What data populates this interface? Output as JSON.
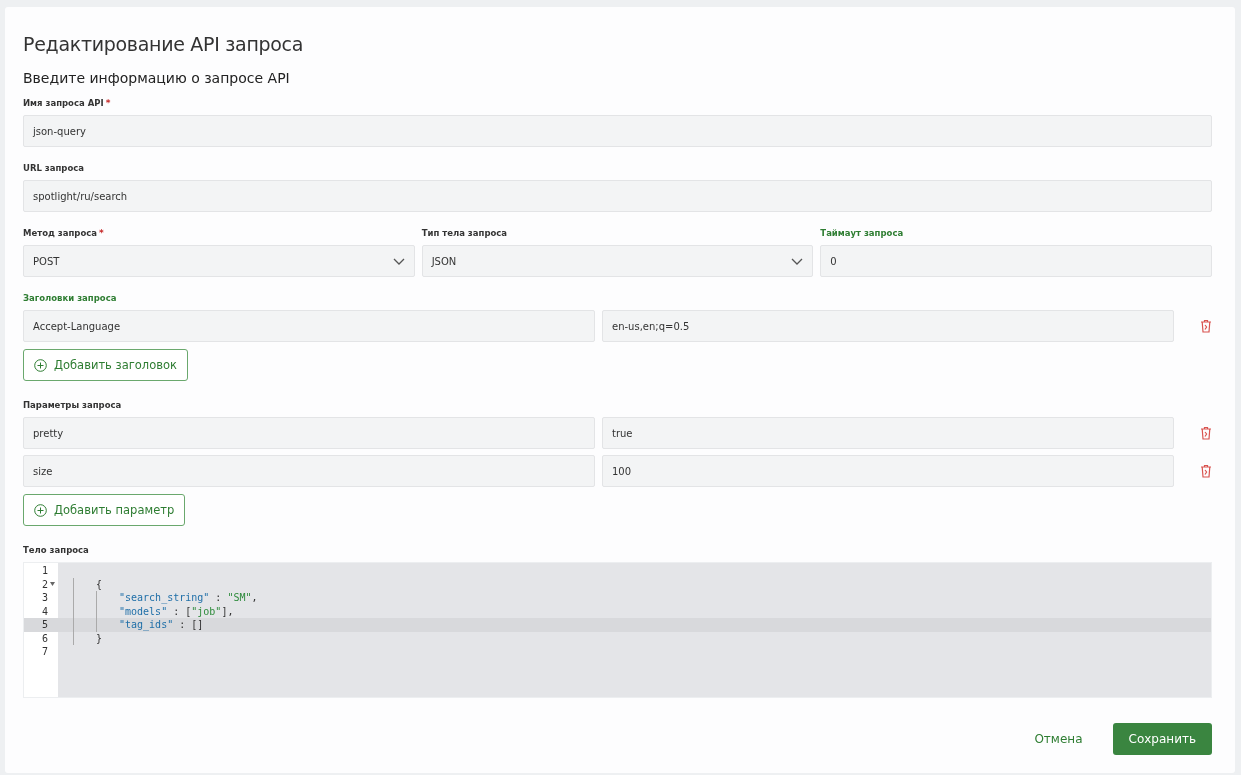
{
  "dialog": {
    "title": "Редактирование API запроса",
    "subtitle": "Введите информацию о запросе API"
  },
  "fields": [
    {
      "label": "Имя запроса API",
      "required_mark": "*",
      "highlighted": false,
      "kind": "text",
      "value": "json-query"
    },
    {
      "label": "URL запроса",
      "highlighted": false,
      "kind": "text",
      "value": "spotlight/ru/search"
    }
  ],
  "row_fields": [
    {
      "label": "Метод запроса",
      "required_mark": "*",
      "highlighted": false,
      "kind": "select",
      "value": "POST"
    },
    {
      "label": "Тип тела запроса",
      "highlighted": false,
      "kind": "select",
      "value": "JSON"
    },
    {
      "label": "Таймаут запроса",
      "highlighted": true,
      "kind": "text",
      "value": "0"
    }
  ],
  "groups": [
    {
      "label": "Заголовки запроса",
      "highlighted": true,
      "rows": [
        {
          "key": "Accept-Language",
          "value": "en-us,en;q=0.5"
        }
      ],
      "add_button": "Добавить заголовок"
    },
    {
      "label": "Параметры запроса",
      "highlighted": false,
      "rows": [
        {
          "key": "pretty",
          "value": "true"
        },
        {
          "key": "size",
          "value": "100"
        }
      ],
      "add_button": "Добавить параметр"
    }
  ],
  "body": {
    "label": "Тело запроса",
    "lines": [
      {
        "number": "1",
        "foldable": false,
        "active": false
      },
      {
        "number": "2",
        "foldable": true,
        "active": false,
        "tokens": [
          {
            "kind": "punct",
            "text": "    {"
          }
        ]
      },
      {
        "number": "3",
        "foldable": false,
        "active": false,
        "tokens": [
          {
            "kind": "key",
            "text": "        \"search_string\""
          },
          {
            "kind": "punct",
            "text": " : "
          },
          {
            "kind": "string",
            "text": "\"SM\""
          },
          {
            "kind": "punct",
            "text": ","
          }
        ]
      },
      {
        "number": "4",
        "foldable": false,
        "active": false,
        "tokens": [
          {
            "kind": "key",
            "text": "        \"models\""
          },
          {
            "kind": "punct",
            "text": " : ["
          },
          {
            "kind": "string",
            "text": "\"job\""
          },
          {
            "kind": "punct",
            "text": "],"
          }
        ]
      },
      {
        "number": "5",
        "foldable": false,
        "active": true,
        "tokens": [
          {
            "kind": "key",
            "text": "        \"tag_ids\""
          },
          {
            "kind": "punct",
            "text": " : []"
          }
        ]
      },
      {
        "number": "6",
        "foldable": false,
        "active": false,
        "tokens": [
          {
            "kind": "punct",
            "text": "    }"
          }
        ]
      },
      {
        "number": "7",
        "foldable": false,
        "active": false
      }
    ]
  },
  "footer": {
    "cancel": "Отмена",
    "save": "Сохранить"
  }
}
